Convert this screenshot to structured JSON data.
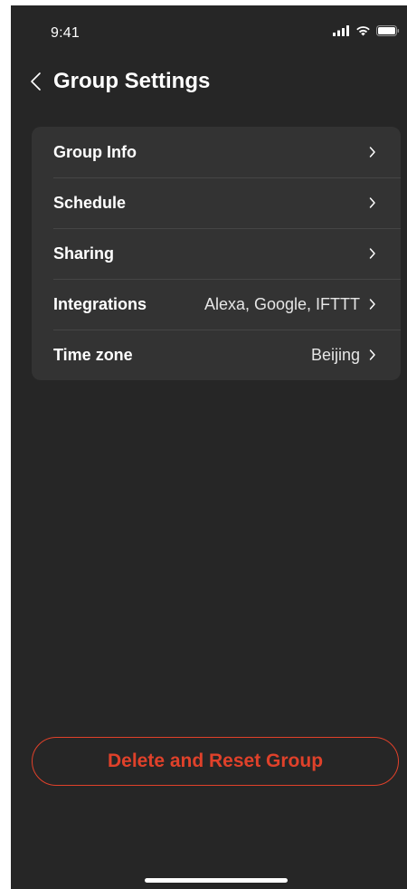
{
  "status_bar": {
    "time": "9:41",
    "icons": [
      "cellular-signal-icon",
      "wifi-icon",
      "battery-icon"
    ]
  },
  "header": {
    "title": "Group Settings",
    "back_icon": "chevron-left-icon"
  },
  "settings": {
    "items": [
      {
        "label": "Group Info",
        "value": ""
      },
      {
        "label": "Schedule",
        "value": ""
      },
      {
        "label": "Sharing",
        "value": ""
      },
      {
        "label": "Integrations",
        "value": "Alexa, Google, IFTTT"
      },
      {
        "label": "Time zone",
        "value": "Beijing"
      }
    ],
    "row_icon": "chevron-right-icon"
  },
  "actions": {
    "delete_label": "Delete and Reset Group"
  },
  "colors": {
    "background": "#262626",
    "card": "#333333",
    "divider": "#454545",
    "text": "#ffffff",
    "danger": "#e0412a"
  }
}
